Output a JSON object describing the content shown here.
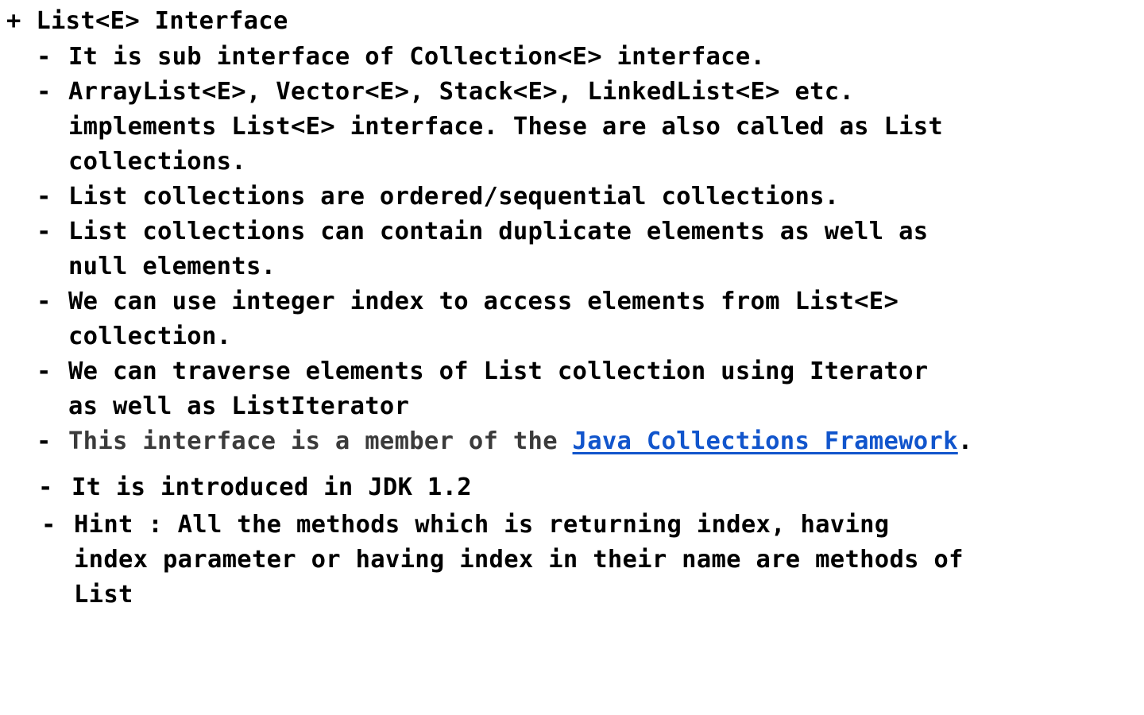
{
  "heading": {
    "marker": "+",
    "text": "List<E> Interface"
  },
  "bullets": [
    {
      "dash": "-",
      "lines": [
        "It is sub interface of Collection<E> interface."
      ]
    },
    {
      "dash": "-",
      "lines": [
        "ArrayList<E>, Vector<E>, Stack<E>, LinkedList<E> etc.",
        "implements List<E> interface. These are also called as List",
        "collections."
      ]
    },
    {
      "dash": "-",
      "lines": [
        "List collections are ordered/sequential collections."
      ]
    },
    {
      "dash": "-",
      "lines": [
        "List collections can contain duplicate elements as well as",
        "null elements."
      ]
    },
    {
      "dash": "-",
      "lines": [
        "We can use integer index to access elements from List<E>",
        "collection."
      ]
    },
    {
      "dash": "-",
      "lines": [
        "We can traverse elements of List collection using Iterator",
        "as well as ListIterator"
      ]
    },
    {
      "dash": "-",
      "prefix": "This interface is a member of the ",
      "link_text": "Java Collections Framework",
      "suffix": "."
    },
    {
      "dash": "-",
      "lines": [
        "It is introduced in JDK 1.2"
      ]
    },
    {
      "dash": "-",
      "lines": [
        "Hint : All the methods which is returning index, having",
        "index parameter or having index in their name are methods of",
        "List"
      ]
    }
  ]
}
